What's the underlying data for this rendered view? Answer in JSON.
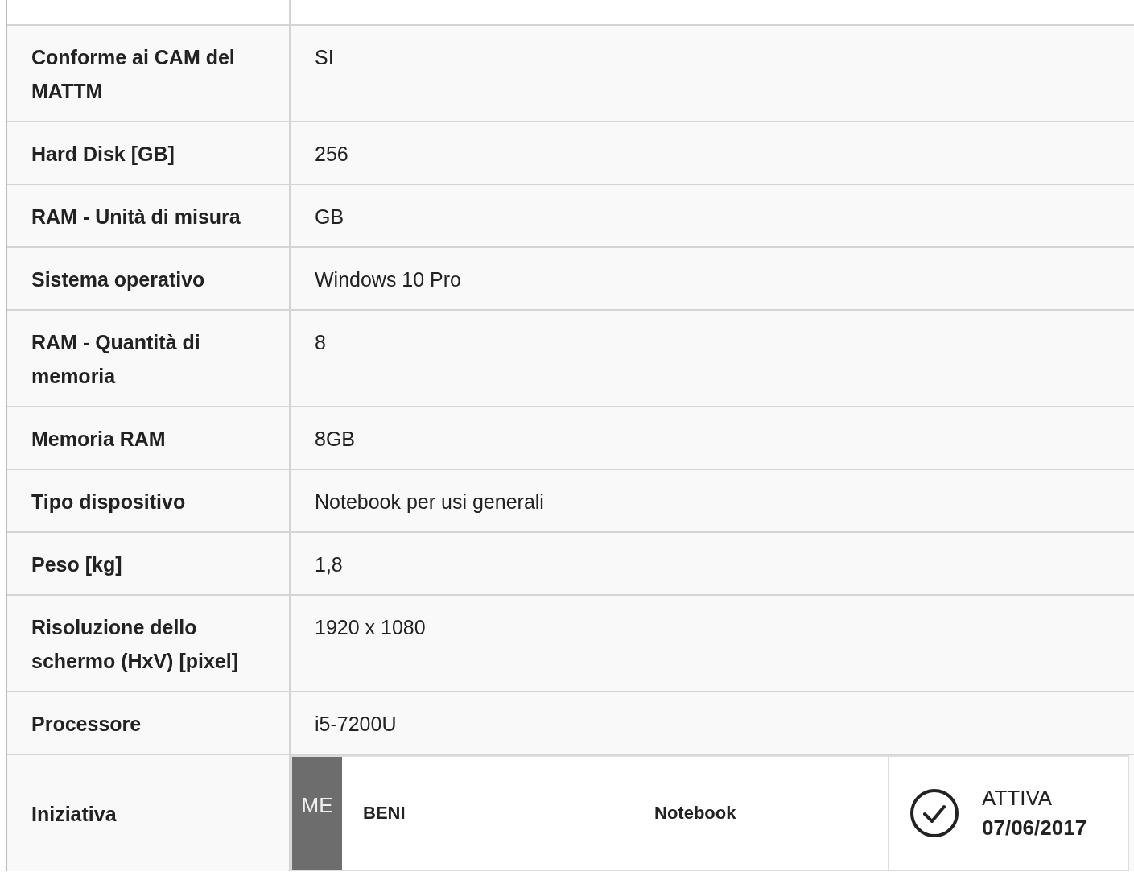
{
  "attributes": [
    {
      "label": "Conforme ai CAM del MATTM",
      "value": "SI"
    },
    {
      "label": "Hard Disk [GB]",
      "value": "256"
    },
    {
      "label": "RAM - Unità di misura",
      "value": "GB"
    },
    {
      "label": "Sistema operativo",
      "value": "Windows 10 Pro"
    },
    {
      "label": "RAM - Quantità di memoria",
      "value": "8"
    },
    {
      "label": "Memoria RAM",
      "value": "8GB"
    },
    {
      "label": "Tipo dispositivo",
      "value": "Notebook per usi generali"
    },
    {
      "label": "Peso [kg]",
      "value": "1,8"
    },
    {
      "label": "Risoluzione dello schermo (HxV) [pixel]",
      "value": "1920 x 1080"
    },
    {
      "label": "Processore",
      "value": "i5-7200U"
    }
  ],
  "initiative": {
    "label": "Iniziativa",
    "badge": "ME",
    "category": "BENI",
    "product": "Notebook",
    "status": "ATTIVA",
    "date": "07/06/2017"
  }
}
